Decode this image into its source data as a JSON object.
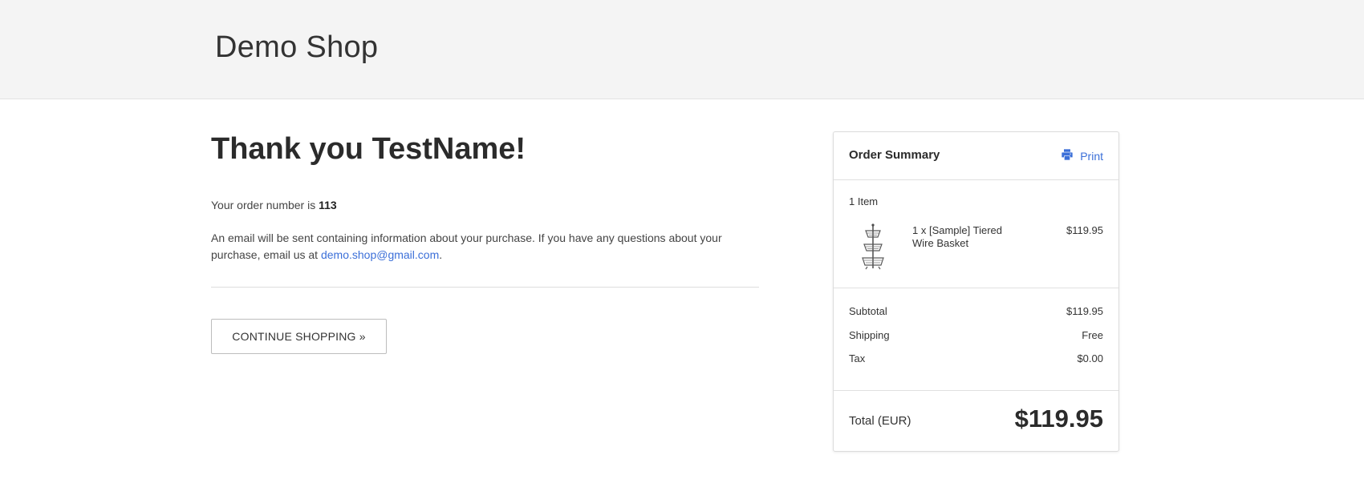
{
  "header": {
    "logo": "Demo Shop"
  },
  "main": {
    "heading": "Thank you TestName!",
    "order_prefix": "Your order number is ",
    "order_number": "113",
    "email_text": "An email will be sent containing information about your purchase. If you have any questions about your purchase, email us at ",
    "email_link": "demo.shop@gmail.com",
    "email_suffix": ".",
    "continue_label": "CONTINUE SHOPPING »"
  },
  "summary": {
    "title": "Order Summary",
    "print_label": "Print",
    "item_count": "1 Item",
    "item": {
      "name": "1 x [Sample] Tiered Wire Basket",
      "price": "$119.95"
    },
    "subtotal_label": "Subtotal",
    "subtotal_value": "$119.95",
    "shipping_label": "Shipping",
    "shipping_value": "Free",
    "tax_label": "Tax",
    "tax_value": "$0.00",
    "total_label": "Total (EUR)",
    "total_value": "$119.95"
  },
  "colors": {
    "link": "#3b6fd8",
    "header_bg": "#f4f4f4",
    "text": "#333333"
  },
  "icons": {
    "print": "printer-icon"
  }
}
